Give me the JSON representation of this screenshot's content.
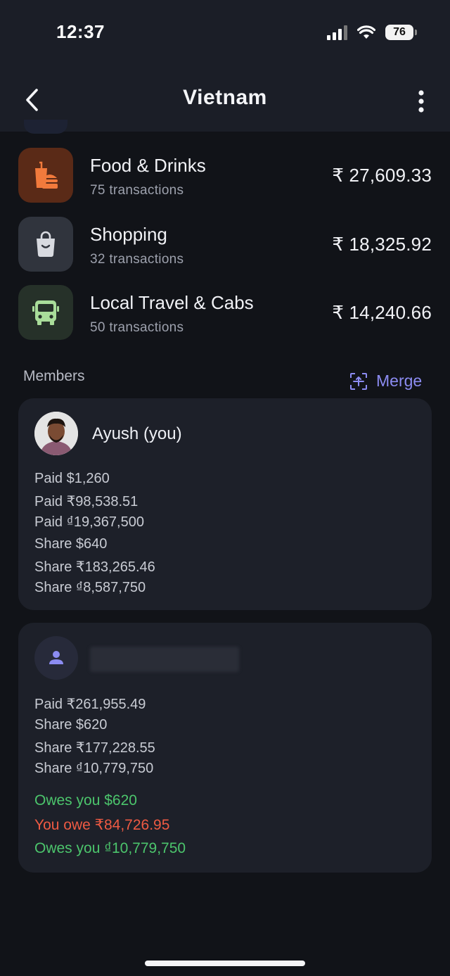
{
  "status_bar": {
    "time": "12:37",
    "battery": "76"
  },
  "nav": {
    "title": "Vietnam"
  },
  "categories": [
    {
      "name": "Food & Drinks",
      "transactions": "75 transactions",
      "amount": "₹ 27,609.33",
      "icon": "food-drinks-icon",
      "bg": "#5a2a17",
      "color": "#f27a3c"
    },
    {
      "name": "Shopping",
      "transactions": "32 transactions",
      "amount": "₹ 18,325.92",
      "icon": "shopping-bag-icon",
      "bg": "#30343d",
      "color": "#d8dae0"
    },
    {
      "name": "Local Travel & Cabs",
      "transactions": "50 transactions",
      "amount": "₹ 14,240.66",
      "icon": "bus-icon",
      "bg": "#263129",
      "color": "#a9dd9a"
    }
  ],
  "members": {
    "label": "Members",
    "merge_label": "Merge",
    "list": [
      {
        "name": "Ayush (you)",
        "lines": [
          "Paid $1,260",
          "Paid ₹98,538.51",
          "Paid ₫19,367,500",
          "Share $640",
          "Share ₹183,265.46",
          "Share ₫8,587,750"
        ]
      },
      {
        "name": "",
        "lines": [
          "Paid ₹261,955.49",
          "Share $620",
          "Share ₹177,228.55",
          "Share ₫10,779,750"
        ],
        "balances": [
          {
            "text": "Owes you $620",
            "type": "positive"
          },
          {
            "text": "You owe ₹84,726.95",
            "type": "negative"
          },
          {
            "text": "Owes you ₫10,779,750",
            "type": "positive"
          }
        ]
      }
    ]
  },
  "colors": {
    "accent": "#8c8cf2",
    "positive": "#4cc56c",
    "negative": "#ee5a43",
    "background": "#111318",
    "card": "#1d2029"
  }
}
